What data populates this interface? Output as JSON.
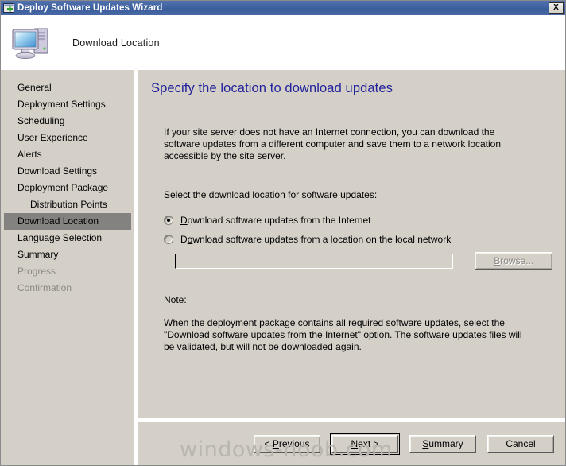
{
  "window": {
    "title": "Deploy Software Updates Wizard",
    "title_icon": "wizard-window-plus-icon",
    "close_label": "X"
  },
  "header": {
    "icon": "computer-monitor-icon",
    "page_title": "Download Location"
  },
  "sidebar": {
    "items": [
      {
        "label": "General",
        "state": "normal",
        "sub": false
      },
      {
        "label": "Deployment Settings",
        "state": "normal",
        "sub": false
      },
      {
        "label": "Scheduling",
        "state": "normal",
        "sub": false
      },
      {
        "label": "User Experience",
        "state": "normal",
        "sub": false
      },
      {
        "label": "Alerts",
        "state": "normal",
        "sub": false
      },
      {
        "label": "Download Settings",
        "state": "normal",
        "sub": false
      },
      {
        "label": "Deployment Package",
        "state": "normal",
        "sub": false
      },
      {
        "label": "Distribution Points",
        "state": "normal",
        "sub": true
      },
      {
        "label": "Download Location",
        "state": "selected",
        "sub": false
      },
      {
        "label": "Language Selection",
        "state": "normal",
        "sub": false
      },
      {
        "label": "Summary",
        "state": "normal",
        "sub": false
      },
      {
        "label": "Progress",
        "state": "disabled",
        "sub": false
      },
      {
        "label": "Confirmation",
        "state": "disabled",
        "sub": false
      }
    ]
  },
  "content": {
    "heading": "Specify the location to download updates",
    "intro": "If your site server does not have an Internet connection, you can download the software updates from a different computer and save them to a network location accessible by the site server.",
    "select_label": "Select the download location for software updates:",
    "radio_internet": {
      "label": "Download software updates from the Internet",
      "accel": "D",
      "checked": true
    },
    "radio_local": {
      "label": "Download software updates from a location on the local network",
      "accel": "o",
      "checked": false
    },
    "path_input": {
      "value": "",
      "placeholder": "",
      "enabled": false
    },
    "browse_button": {
      "label": "Browse...",
      "accel": "B",
      "enabled": false
    },
    "note_title": "Note:",
    "note_body": "When the deployment package contains all required software updates, select the \"Download software updates from the Internet\" option. The software updates files will be validated, but will not be downloaded again."
  },
  "footer": {
    "buttons": [
      {
        "label": "< Previous",
        "accel": "P",
        "default": false
      },
      {
        "label": "Next >",
        "accel": "N",
        "default": true
      },
      {
        "label": "Summary",
        "accel": "S",
        "default": false
      },
      {
        "label": "Cancel",
        "accel": "",
        "default": false
      }
    ]
  },
  "watermark": "windows-noob.com",
  "colors": {
    "titlebar": "#3f62a0",
    "dialog_face": "#d4d0c8",
    "heading": "#22229c",
    "selection": "#848280",
    "disabled_text": "#8b8985"
  }
}
